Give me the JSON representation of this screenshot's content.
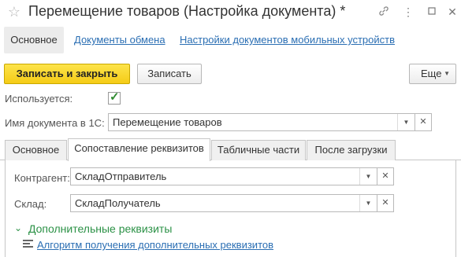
{
  "window": {
    "title": "Перемещение товаров (Настройка документа) *",
    "icons": [
      "star-icon",
      "link-icon",
      "more-icon",
      "maximize-icon",
      "close-icon"
    ]
  },
  "nav": {
    "main": "Основное",
    "links": [
      "Документы обмена",
      "Настройки документов мобильных устройств"
    ]
  },
  "toolbar": {
    "save_close": "Записать и закрыть",
    "save": "Записать",
    "more": "Еще"
  },
  "form": {
    "used_label": "Используется:",
    "used_checked": true,
    "doc_name_label": "Имя документа в 1С:",
    "doc_name_value": "Перемещение товаров"
  },
  "tabs": [
    {
      "label": "Основное",
      "active": false
    },
    {
      "label": "Сопоставление реквизитов",
      "active": true
    },
    {
      "label": "Табличные части",
      "active": false
    },
    {
      "label": "После загрузки",
      "active": false
    }
  ],
  "mapping": {
    "counterparty_label": "Контрагент:",
    "counterparty_value": "СкладОтправитель",
    "warehouse_label": "Склад:",
    "warehouse_value": "СкладПолучатель"
  },
  "extra": {
    "group_title": "Дополнительные реквизиты",
    "algorithm_link": "Алгоритм получения дополнительных реквизитов"
  },
  "colors": {
    "accent_yellow": "#f5cc17",
    "link_blue": "#2a6eb3",
    "group_green": "#2b9146"
  }
}
